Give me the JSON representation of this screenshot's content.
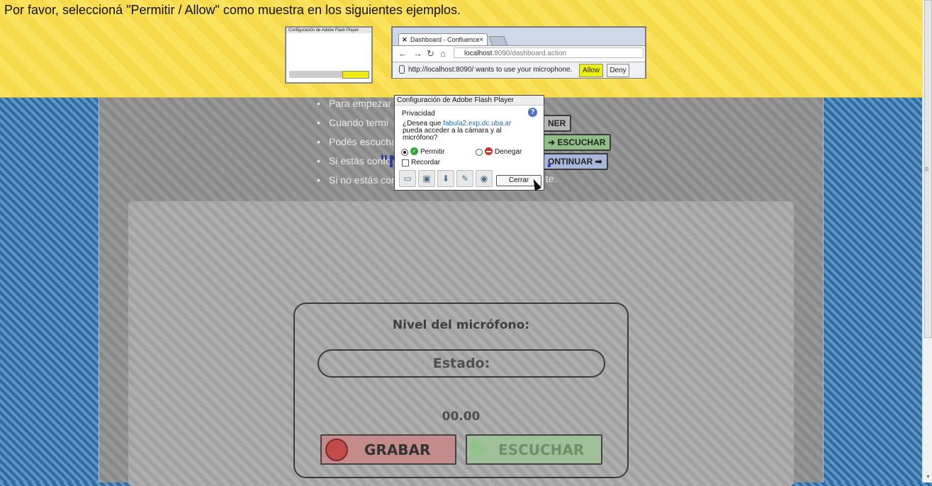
{
  "banner": {
    "text": "Por favor, seleccioná \"Permitir / Allow\" como muestra en los siguientes ejemplos.",
    "thumb": {
      "title": "Configuración de Adobe Flash Player"
    },
    "browser_example": {
      "tab_title": "Dashboard - Confluence",
      "url_host": "localhost",
      "url_path": ":8090/dashboard.action",
      "notification": "http://localhost:8090/ wants to use your microphone.",
      "allow_label": "Allow",
      "deny_label": "Deny"
    }
  },
  "instructions": [
    "Para empezar",
    "Cuando termi",
    "Podés escucha",
    "Si estás confor",
    "Si no estás cor"
  ],
  "instruction_buttons": {
    "detener": "NER",
    "escuchar": "➜ ESCUCHAR",
    "continuar": "ONTINUAR ➡",
    "trailing": "te."
  },
  "quote": "\"No dudes, actúa\".",
  "mic": {
    "title": "Nivel del micrófono:",
    "status_label": "Estado:",
    "timer": "00.00",
    "record_label": "GRABAR",
    "listen_label": "ESCUCHAR"
  },
  "flash_dialog": {
    "title": "Configuración de Adobe Flash Player",
    "section": "Privacidad",
    "help": "?",
    "question_prefix": "¿Desea que ",
    "host": "fabula2.exp.dc.uba.ar",
    "question_suffix": "pueda acceder a la cámara y al micrófono?",
    "allow_label": "Permitir",
    "deny_label": "Denegar",
    "remember_label": "Recordar",
    "close_label": "Cerrar",
    "selected": "Permitir"
  },
  "colors": {
    "banner_yellow": "#fbe25c",
    "background_blue": "#3f7fb2",
    "quote_blue": "#2f3d98",
    "allow_highlight": "#ecef12"
  }
}
